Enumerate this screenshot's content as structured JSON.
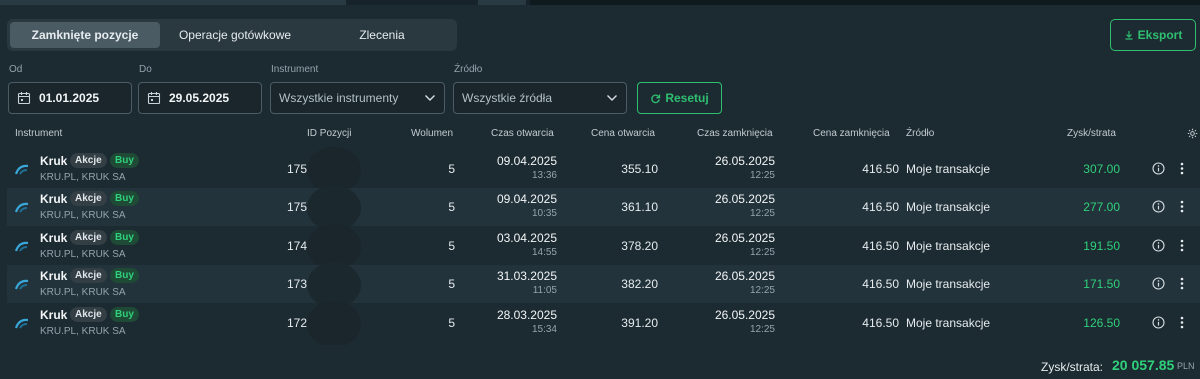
{
  "tabs": [
    {
      "label": "Zamknięte pozycje",
      "active": true
    },
    {
      "label": "Operacje gotówkowe",
      "active": false
    },
    {
      "label": "Zlecenia",
      "active": false
    }
  ],
  "export_label": "Eksport",
  "filters": {
    "from_label": "Od",
    "from_value": "01.01.2025",
    "to_label": "Do",
    "to_value": "29.05.2025",
    "instrument_label": "Instrument",
    "instrument_value": "Wszystkie instrumenty",
    "source_label": "Źródło",
    "source_value": "Wszystkie źródła",
    "reset_label": "Resetuj"
  },
  "columns": {
    "instrument": "Instrument",
    "id": "ID Pozycji",
    "volume": "Wolumen",
    "open_time": "Czas otwarcia",
    "open_price": "Cena otwarcia",
    "close_time": "Czas zamknięcia",
    "close_price": "Cena zamknięcia",
    "source": "Źródło",
    "pl": "Zysk/strata"
  },
  "rows": [
    {
      "name": "Kruk",
      "type": "Akcje",
      "side": "Buy",
      "sub": "KRU.PL, KRUK SA",
      "id": "1756",
      "volume": "5",
      "open_date": "09.04.2025",
      "open_time": "13:36",
      "open_price": "355.10",
      "close_date": "26.05.2025",
      "close_time": "12:25",
      "close_price": "416.50",
      "source": "Moje transakcje",
      "pl": "307.00"
    },
    {
      "name": "Kruk",
      "type": "Akcje",
      "side": "Buy",
      "sub": "KRU.PL, KRUK SA",
      "id": "1755",
      "volume": "5",
      "open_date": "09.04.2025",
      "open_time": "10:35",
      "open_price": "361.10",
      "close_date": "26.05.2025",
      "close_time": "12:25",
      "close_price": "416.50",
      "source": "Moje transakcje",
      "pl": "277.00"
    },
    {
      "name": "Kruk",
      "type": "Akcje",
      "side": "Buy",
      "sub": "KRU.PL, KRUK SA",
      "id": "1740",
      "volume": "5",
      "open_date": "03.04.2025",
      "open_time": "14:55",
      "open_price": "378.20",
      "close_date": "26.05.2025",
      "close_time": "12:25",
      "close_price": "416.50",
      "source": "Moje transakcje",
      "pl": "191.50"
    },
    {
      "name": "Kruk",
      "type": "Akcje",
      "side": "Buy",
      "sub": "KRU.PL, KRUK SA",
      "id": "1731",
      "volume": "5",
      "open_date": "31.03.2025",
      "open_time": "11:05",
      "open_price": "382.20",
      "close_date": "26.05.2025",
      "close_time": "12:25",
      "close_price": "416.50",
      "source": "Moje transakcje",
      "pl": "171.50"
    },
    {
      "name": "Kruk",
      "type": "Akcje",
      "side": "Buy",
      "sub": "KRU.PL, KRUK SA",
      "id": "1729",
      "volume": "5",
      "open_date": "28.03.2025",
      "open_time": "15:34",
      "open_price": "391.20",
      "close_date": "26.05.2025",
      "close_time": "12:25",
      "close_price": "416.50",
      "source": "Moje transakcje",
      "pl": "126.50"
    }
  ],
  "footer": {
    "label": "Zysk/strata:",
    "value": "20 057.85",
    "currency": "PLN"
  },
  "colors": {
    "accent_green": "#2fbf71",
    "profit_green": "#2fd17b",
    "background": "#1c2a31"
  },
  "icons": [
    "calendar-icon",
    "chevron-down-icon",
    "refresh-icon",
    "download-icon",
    "settings-gear-icon",
    "info-icon",
    "more-vertical-icon",
    "instrument-logo-icon"
  ]
}
